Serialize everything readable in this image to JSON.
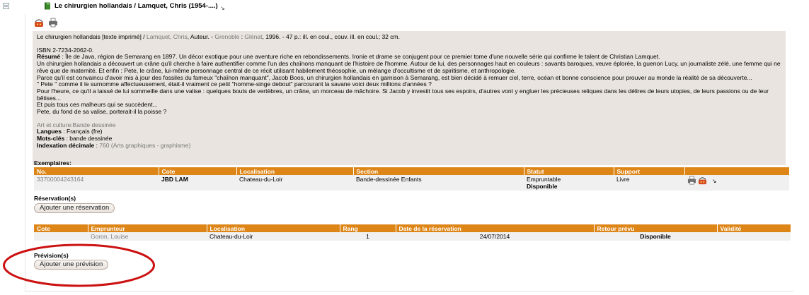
{
  "header": {
    "title": "Le chirurgien hollandais / Lamquet, Chris (1954-....)"
  },
  "notice": {
    "title_main": "Le chirurgien hollandais [texte imprimé] / ",
    "author_link": "Lamquet, Chris",
    "author_role": ", Auteur. - ",
    "place_link": "Grenoble",
    "publisher_sep": " : ",
    "publisher_link": "Glénat",
    "pub_details": ", 1996. - 47 p.: ill. en coul., couv. ill. en coul.; 32 cm.",
    "isbn": "ISBN 2-7234-2062-0.",
    "resume_label": "Résumé",
    "resume_lines": [
      " : Île de Java, région de Semarang en 1897. Un décor exotique pour une aventure riche en rebondissements. Ironie et drame se conjugent pour ce premier tome d'une nouvelle série qui confirme le talent de Christian Lamquet.",
      "Un chirurgien hollandais a découvert un crâne qu'il cherche à faire authentifier comme l'un des chaînons manquant de l'histoire de l'homme. Autour de lui, des personnages haut en couleurs : savants baroques, veuve éplorée, la guenon Lucy, un journaliste zélé, une femme qui ne rêve que de maternité. Et enfin : Pete, le crâne, lui-même personnage central de ce récit utilisant habilement théosophie, un mélange d'occultisme et de spiritisme, et anthropologie.",
      "Parce qu'il est convaincu d'avoir mis à jour des fossiles du fameux \"chaînon manquant\", Jacob Boos, un chirurgien hollandais en garnison à Semarang, est bien décidé à remuer ciel, terre, océan et bonne conscience pour prouver au monde la réalité de sa découverte...",
      "\" Pete \" comme il le surnomme affectueusement, était-il vraiment ce petit \"homme-singe debout\" parcourant la savane voici deux millions d'années ?",
      "Pour l'heure, ce qu'il a laissé de lui sommeille dans une valise : quelques bouts de vertèbres, un crâne, un morceau de mâchoire. Si Jacob y investit tous ses espoirs, d'autres vont y engluer les précieuses reliques dans les délires de leurs utopies, de leurs passions ou de leur bêtises...",
      "Et puis tous ces malheurs qui se succèdent...",
      "Pete, du fond de sa valise, porterait-il la poisse ?"
    ],
    "category_link": "Art et culture:Bande dessinée",
    "langues_label": "Langues",
    "langues_value": " : Français (fre)",
    "motscles_label": "Mots-clés",
    "motscles_value": " : bande dessinée",
    "indexation_label": "Indexation décimale",
    "indexation_sep": " : ",
    "indexation_value": "760 (Arts graphiques - graphisme)"
  },
  "exemplaires": {
    "label": "Exemplaires:",
    "columns": [
      "No.",
      "Cote",
      "Localisation",
      "Section",
      "Statut",
      "Support",
      ""
    ],
    "row": {
      "no": "33700004243164",
      "cote": "JBD LAM",
      "localisation": "Chateau-du-Loir",
      "section": "Bande-dessinée Enfants",
      "statut_line1": "Empruntable",
      "statut_line2": "Disponible",
      "support": "Livre"
    }
  },
  "reservations": {
    "label": "Réservation(s)",
    "add_button": "Ajouter une réservation",
    "columns": [
      "Cote",
      "Emprunteur",
      "Localisation",
      "Rang",
      "Date de la réservation",
      "Retour prévu",
      "Validité"
    ],
    "row": {
      "cote": "",
      "emprunteur": "Goron, Louise",
      "localisation": "Chateau-du-Loir",
      "rang": "1",
      "date": "24/07/2014",
      "retour": "Disponible",
      "validite": ""
    }
  },
  "previsions": {
    "label": "Prévision(s)",
    "add_button": "Ajouter une prévision"
  },
  "colors": {
    "header_orange": "#dd8517",
    "notice_bg": "#e9e4df",
    "highlight_red": "#cc1111"
  }
}
